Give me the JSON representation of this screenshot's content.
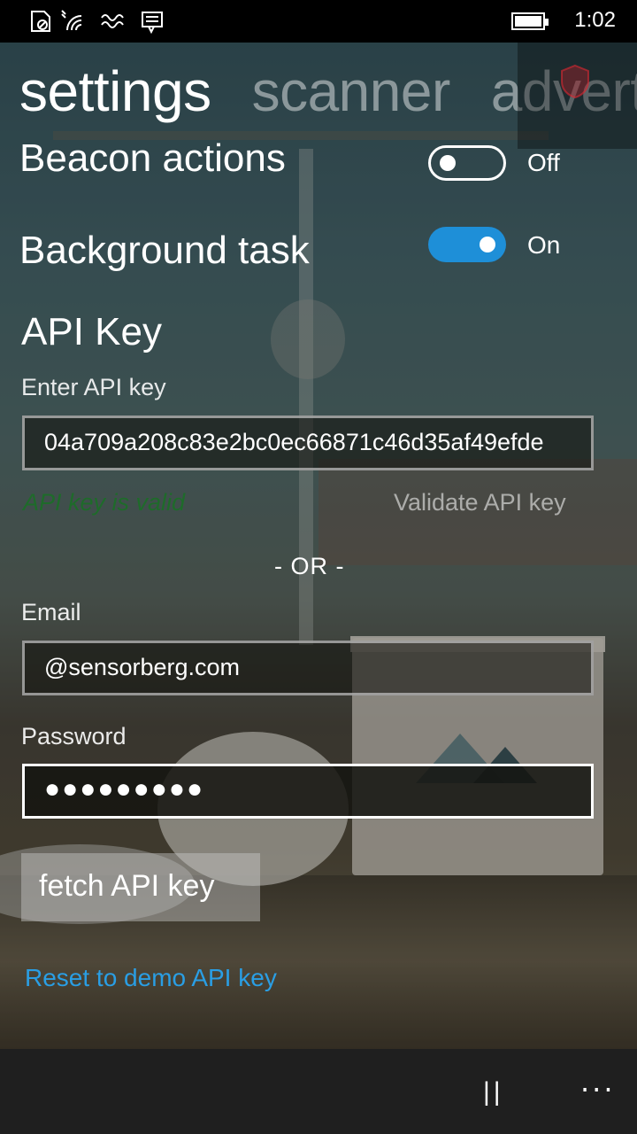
{
  "status_bar": {
    "time": "1:02",
    "icons": [
      "sim-card-icon",
      "wifi-icon",
      "vibrate-icon",
      "message-icon",
      "battery-icon"
    ]
  },
  "pivot": {
    "tabs": [
      {
        "label": "settings",
        "active": true
      },
      {
        "label": "scanner",
        "active": false
      },
      {
        "label": "advert",
        "active": false
      }
    ]
  },
  "settings": {
    "beacon_actions": {
      "label": "Beacon actions",
      "state": "Off"
    },
    "background_task": {
      "label": "Background task",
      "state": "On"
    },
    "api_key_heading": "API Key",
    "api_key_field_label": "Enter API key",
    "api_key_value": "04a709a208c83e2bc0ec66871c46d35af49efde",
    "api_key_status": "API key is valid",
    "validate_label": "Validate API key",
    "or_separator": "- OR -",
    "email_label": "Email",
    "email_value": "@sensorberg.com",
    "password_label": "Password",
    "password_mask": "●●●●●●●●●",
    "fetch_label": "fetch API key",
    "reset_label": "Reset to demo API key"
  },
  "app_bar": {
    "pause_glyph": "||",
    "more_glyph": "..."
  },
  "colors": {
    "accent": "#1e8fd8",
    "link": "#2a9ee4",
    "valid_text": "#1e6b2a"
  }
}
